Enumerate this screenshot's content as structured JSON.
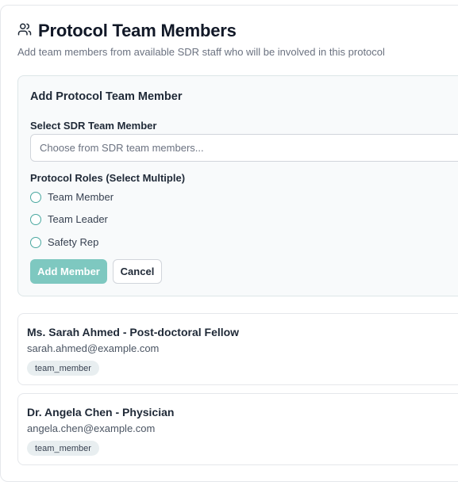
{
  "header": {
    "title": "Protocol Team Members",
    "subtitle": "Add team members from available SDR staff who will be involved in this protocol",
    "icon": "users-icon"
  },
  "add_panel": {
    "title": "Add Protocol Team Member",
    "select_label": "Select SDR Team Member",
    "select_placeholder": "Choose from SDR team members...",
    "roles_label": "Protocol Roles (Select Multiple)",
    "roles": [
      {
        "label": "Team Member",
        "checked": false
      },
      {
        "label": "Team Leader",
        "checked": false
      },
      {
        "label": "Safety Rep",
        "checked": false
      }
    ],
    "add_button": "Add Member",
    "cancel_button": "Cancel"
  },
  "members": [
    {
      "name": "Ms. Sarah Ahmed - Post-doctoral Fellow",
      "email": "sarah.ahmed@example.com",
      "role": "team_member"
    },
    {
      "name": "Dr. Angela Chen - Physician",
      "email": "angela.chen@example.com",
      "role": "team_member"
    }
  ],
  "colors": {
    "accent": "#4aa8a0",
    "add_button_bg": "#7ec8c0",
    "badge_bg": "#e8eef0"
  }
}
